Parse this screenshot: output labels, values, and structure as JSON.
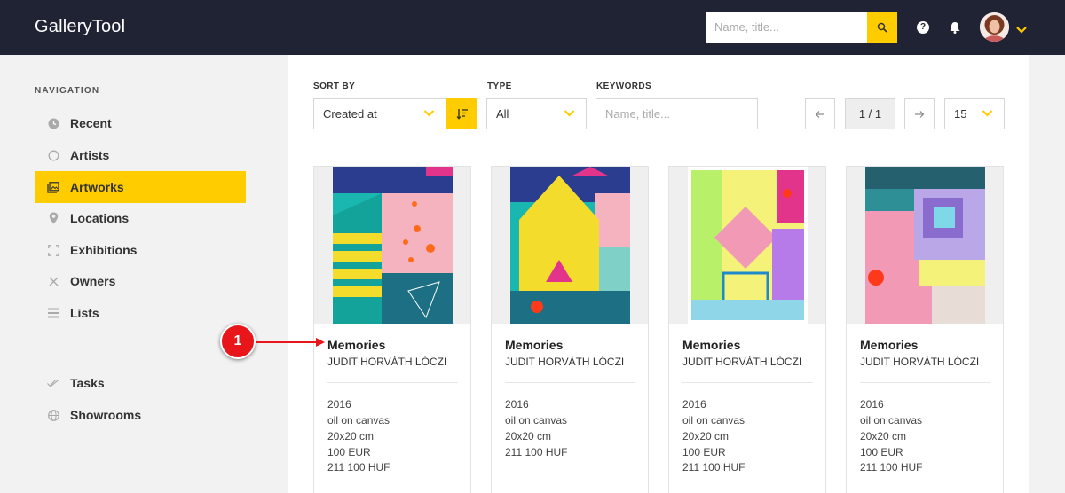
{
  "app": {
    "title": "GalleryTool"
  },
  "header": {
    "search_placeholder": "Name, title...",
    "help_label": "?"
  },
  "sidebar": {
    "heading": "NAVIGATION",
    "items": [
      {
        "label": "Recent",
        "icon": "clock-icon"
      },
      {
        "label": "Artists",
        "icon": "circle-icon"
      },
      {
        "label": "Artworks",
        "icon": "image-icon",
        "active": true
      },
      {
        "label": "Locations",
        "icon": "map-pin-icon"
      },
      {
        "label": "Exhibitions",
        "icon": "frame-icon"
      },
      {
        "label": "Owners",
        "icon": "x-icon"
      },
      {
        "label": "Lists",
        "icon": "list-icon"
      },
      {
        "label": "Tasks",
        "icon": "double-check-icon"
      },
      {
        "label": "Showrooms",
        "icon": "globe-icon"
      }
    ]
  },
  "filters": {
    "sort_by": {
      "label": "SORT BY",
      "value": "Created at"
    },
    "type": {
      "label": "TYPE",
      "value": "All"
    },
    "keywords": {
      "label": "KEYWORDS",
      "placeholder": "Name, title..."
    }
  },
  "pagination": {
    "indicator": "1 / 1",
    "page_size": "15"
  },
  "artworks": [
    {
      "title": "Memories",
      "artist": "JUDIT HORVÁTH LÓCZI",
      "year": "2016",
      "medium": "oil on canvas",
      "size": "20x20 cm",
      "price_eur": "100 EUR",
      "price_huf": "211 100 HUF"
    },
    {
      "title": "Memories",
      "artist": "JUDIT HORVÁTH LÓCZI",
      "year": "2016",
      "medium": "oil on canvas",
      "size": "20x20 cm",
      "price_eur": "",
      "price_huf": "211 100 HUF"
    },
    {
      "title": "Memories",
      "artist": "JUDIT HORVÁTH LÓCZI",
      "year": "2016",
      "medium": "oil on canvas",
      "size": "20x20 cm",
      "price_eur": "100 EUR",
      "price_huf": "211 100 HUF"
    },
    {
      "title": "Memories",
      "artist": "JUDIT HORVÁTH LÓCZI",
      "year": "2016",
      "medium": "oil on canvas",
      "size": "20x20 cm",
      "price_eur": "100 EUR",
      "price_huf": "211 100 HUF"
    }
  ],
  "annotation": {
    "number": "1"
  },
  "colors": {
    "accent": "#ffcc00",
    "topbar": "#1f2333",
    "callout": "#e8161b"
  }
}
